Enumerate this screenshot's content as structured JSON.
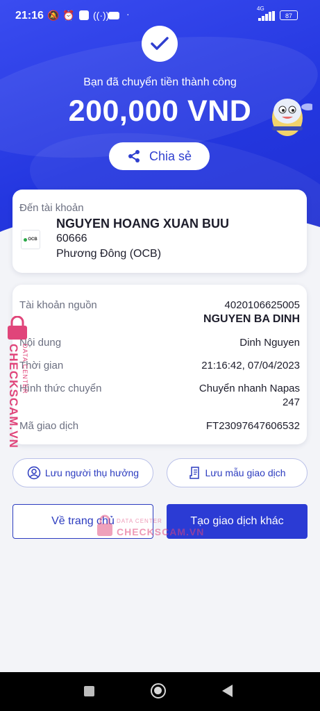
{
  "status_bar": {
    "time": "21:16",
    "network": "4G",
    "battery": "87"
  },
  "hero": {
    "title": "Bạn đã chuyển tiền thành công",
    "amount": "200,000 VND",
    "share_label": "Chia sẻ"
  },
  "recipient": {
    "label": "Đến tài khoản",
    "name": "NGUYEN HOANG XUAN BUU",
    "account": "60666",
    "bank": "Phương Đông (OCB)",
    "bank_logo_text": "OCB"
  },
  "details": {
    "source_label": "Tài khoản nguồn",
    "source_account": "4020106625005",
    "source_name": "NGUYEN BA DINH",
    "content_label": "Nội dung",
    "content_value": "Dinh Nguyen",
    "time_label": "Thời gian",
    "time_value": "21:16:42, 07/04/2023",
    "method_label": "Hình thức chuyển",
    "method_value_1": "Chuyển nhanh Napas",
    "method_value_2": "247",
    "txn_label": "Mã giao dịch",
    "txn_value": "FT23097647606532"
  },
  "actions": {
    "save_beneficiary": "Lưu người thụ hưởng",
    "save_template": "Lưu mẫu giao dịch",
    "home": "Về trang chủ",
    "new_transaction": "Tạo giao dịch khác"
  },
  "watermark": {
    "side": "CHECKSCAM.VN",
    "side_sub": "DATA CENTER",
    "center_top": "DATA CENTER",
    "center_main": "CHECKSCAM.VN"
  },
  "colors": {
    "brand": "#2b3bd4",
    "hero": "#3046e8",
    "watermark": "#e0457a"
  }
}
